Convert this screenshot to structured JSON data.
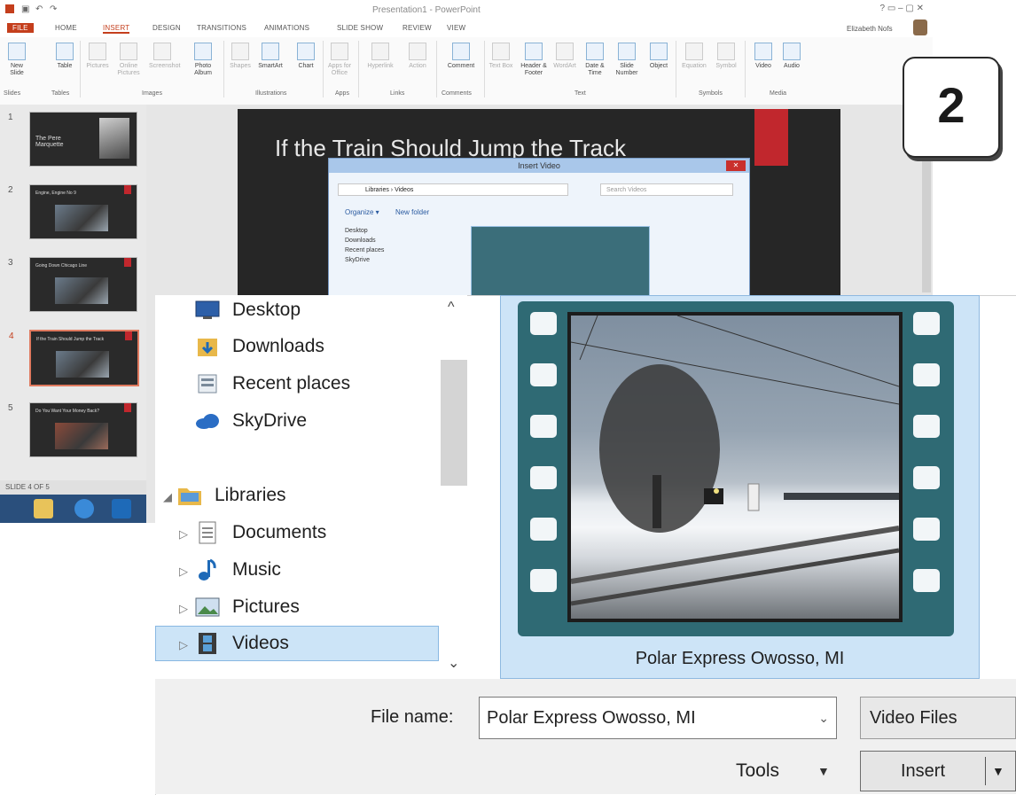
{
  "window": {
    "title": "Presentation1 - PowerPoint",
    "user": "Elizabeth Nofs"
  },
  "ribbon": {
    "tabs": [
      "FILE",
      "HOME",
      "INSERT",
      "DESIGN",
      "TRANSITIONS",
      "ANIMATIONS",
      "SLIDE SHOW",
      "REVIEW",
      "VIEW"
    ],
    "buttons": {
      "new_slide": "New Slide",
      "table": "Table",
      "pictures": "Pictures",
      "online_pictures": "Online Pictures",
      "screenshot": "Screenshot",
      "photo_album": "Photo Album",
      "shapes": "Shapes",
      "smartart": "SmartArt",
      "chart": "Chart",
      "apps_for_office": "Apps for Office",
      "hyperlink": "Hyperlink",
      "action": "Action",
      "comment": "Comment",
      "text_box": "Text Box",
      "header_footer": "Header & Footer",
      "wordart": "WordArt",
      "date_time": "Date & Time",
      "slide_number": "Slide Number",
      "object": "Object",
      "equation": "Equation",
      "symbol": "Symbol",
      "video": "Video",
      "audio": "Audio"
    },
    "groups": [
      "Slides",
      "Tables",
      "Images",
      "Illustrations",
      "Apps",
      "Links",
      "Comments",
      "Text",
      "Symbols",
      "Media"
    ]
  },
  "thumbnails": [
    {
      "num": "1",
      "caption": "The Pere Marquette"
    },
    {
      "num": "2",
      "caption": "Engine, Engine No 9"
    },
    {
      "num": "3",
      "caption": "Going Down Chicago Line"
    },
    {
      "num": "4",
      "caption": "If the Train Should Jump the Track"
    },
    {
      "num": "5",
      "caption": "Do You Want Your Money Back?"
    }
  ],
  "status": "SLIDE 4 OF 5",
  "slide": {
    "title": "If the Train Should Jump the Track"
  },
  "small_dialog": {
    "title": "Insert Video",
    "address": "Libraries › Videos",
    "search_placeholder": "Search Videos",
    "organize": "Organize ▾",
    "new_folder": "New folder",
    "nav": [
      "Desktop",
      "Downloads",
      "Recent places",
      "SkyDrive"
    ]
  },
  "dialog": {
    "nav": {
      "desktop": "Desktop",
      "downloads": "Downloads",
      "recent": "Recent places",
      "skydrive": "SkyDrive",
      "libraries": "Libraries",
      "documents": "Documents",
      "music": "Music",
      "pictures": "Pictures",
      "videos": "Videos"
    },
    "file_item": "Polar Express Owosso, MI",
    "file_name_label": "File name:",
    "file_name_value": "Polar Express Owosso, MI",
    "file_type": "Video Files",
    "tools_label": "Tools",
    "insert_label": "Insert"
  },
  "badge": "2",
  "colors": {
    "accent": "#c43e1c",
    "selection": "#cce4f7",
    "slide_bg": "#262626",
    "slide_red": "#c1272d",
    "film": "#2f6a74"
  }
}
